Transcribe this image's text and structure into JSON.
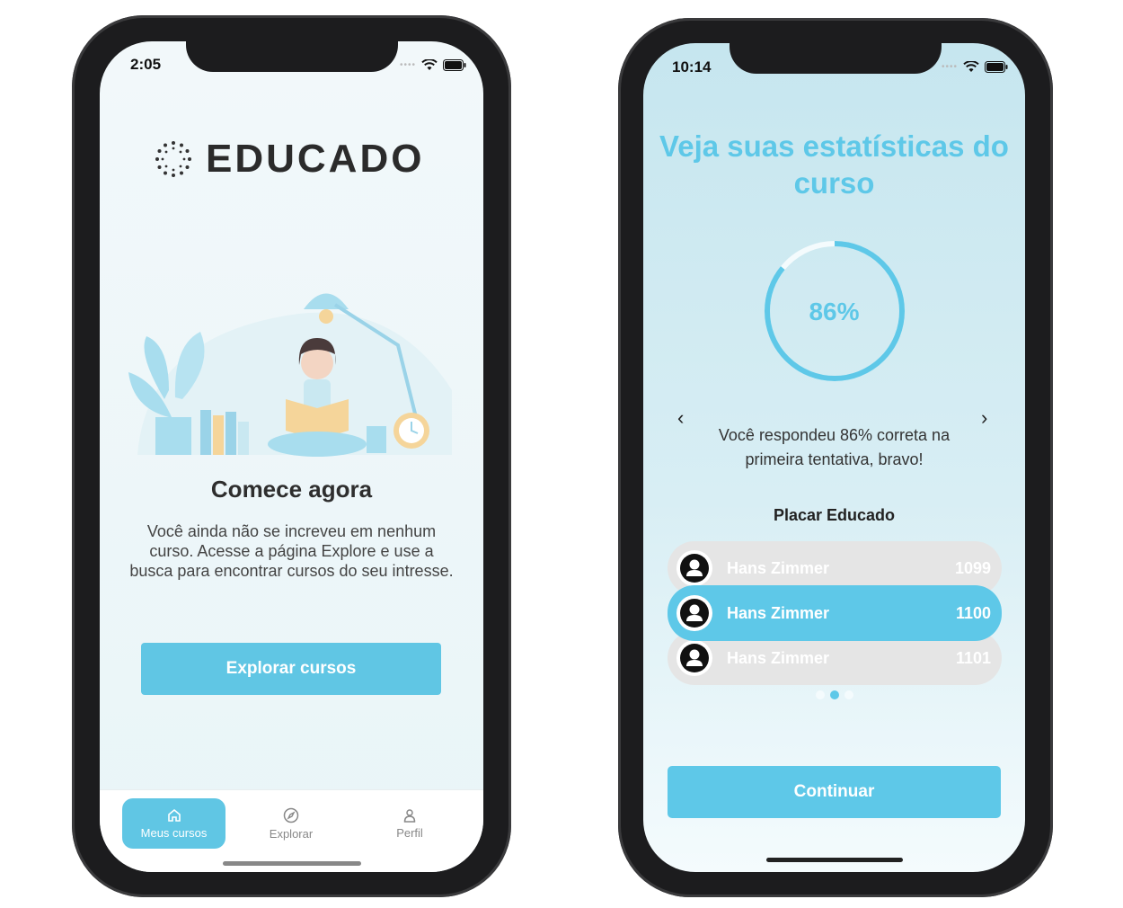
{
  "phone1": {
    "status": {
      "time": "2:05"
    },
    "logo": {
      "text": "EDUCADO"
    },
    "empty_state": {
      "title": "Comece agora",
      "body": "Você ainda não se increveu em nenhum curso. Acesse a página Explore e use a busca para encontrar cursos do seu intresse."
    },
    "explore_button": "Explorar cursos",
    "tabs": [
      {
        "label": "Meus cursos",
        "icon": "home-icon",
        "active": true
      },
      {
        "label": "Explorar",
        "icon": "compass-icon",
        "active": false
      },
      {
        "label": "Perfil",
        "icon": "user-icon",
        "active": false
      }
    ]
  },
  "phone2": {
    "status": {
      "time": "10:14"
    },
    "title": "Veja suas estatísticas do curso",
    "progress": {
      "percent": 86,
      "label": "86%"
    },
    "message": "Você respondeu 86% correta na primeira tentativa, bravo!",
    "leaderboard": {
      "title": "Placar Educado",
      "rows": [
        {
          "name": "Hans Zimmer",
          "score": "1099"
        },
        {
          "name": "Hans Zimmer",
          "score": "1100"
        },
        {
          "name": "Hans Zimmer",
          "score": "1101"
        }
      ],
      "active_index": 1
    },
    "pager": {
      "count": 3,
      "active": 1
    },
    "continue_button": "Continuar"
  },
  "colors": {
    "accent": "#5ec8e8",
    "text_dark": "#2e2e2e"
  }
}
